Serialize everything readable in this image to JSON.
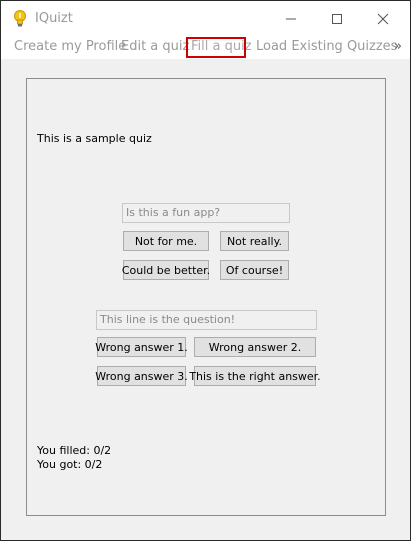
{
  "window": {
    "title": "IQuizt",
    "controls": {
      "minimize": "—",
      "maximize": "☐",
      "close": "✕"
    }
  },
  "menu": {
    "items": [
      {
        "label": "Create my Profile"
      },
      {
        "label": "Edit a quiz"
      },
      {
        "label": "Fill a quiz",
        "active": true
      },
      {
        "label": "Load Existing Quizzes"
      }
    ],
    "overflow_glyph": "»"
  },
  "quiz": {
    "title": "This is a sample quiz",
    "questions": [
      {
        "placeholder": "Is this a fun app?",
        "answers": [
          "Not for me.",
          "Not really.",
          "Could be better.",
          "Of course!"
        ]
      },
      {
        "placeholder": "This line is the question!",
        "answers": [
          "Wrong answer 1.",
          "Wrong answer 2.",
          "Wrong answer 3.",
          "This is the right answer."
        ]
      }
    ]
  },
  "status": {
    "filled": "You filled: 0/2",
    "got": "You got: 0/2"
  },
  "colors": {
    "highlight": "#d00000",
    "icon": "#f2c31b"
  }
}
